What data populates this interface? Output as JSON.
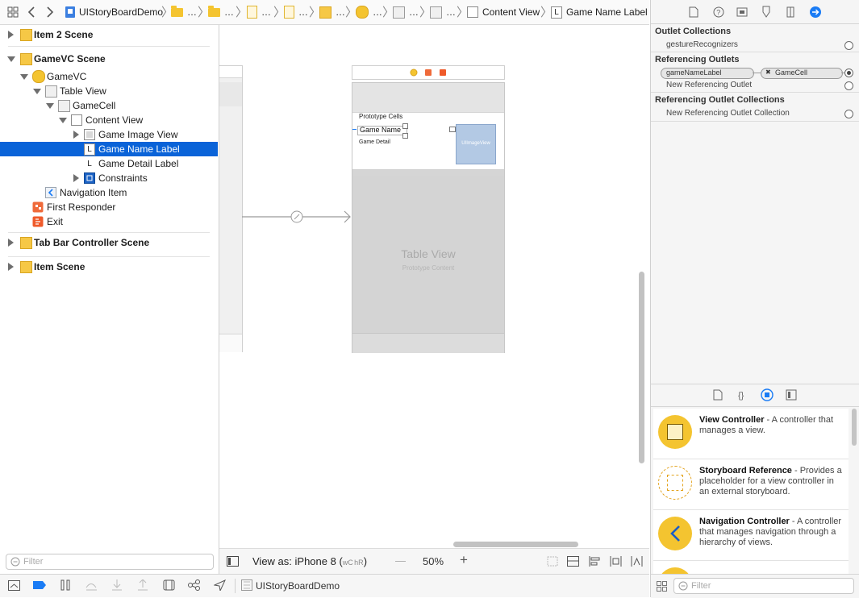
{
  "jumpbar": {
    "project": "UIStoryBoardDemo",
    "ellipsis": "…",
    "content_view": "Content View",
    "label_glyph": "L",
    "selected": "Game Name Label"
  },
  "outline": {
    "items": [
      {
        "label": "Item 2 Scene"
      },
      {
        "label": "GameVC Scene"
      },
      {
        "label": "GameVC"
      },
      {
        "label": "Table View"
      },
      {
        "label": "GameCell"
      },
      {
        "label": "Content View"
      },
      {
        "label": "Game Image View"
      },
      {
        "label": "Game Name Label"
      },
      {
        "label": "Game Detail Label"
      },
      {
        "label": "Constraints"
      },
      {
        "label": "Navigation Item"
      },
      {
        "label": "First Responder"
      },
      {
        "label": "Exit"
      },
      {
        "label": "Tab Bar Controller Scene"
      },
      {
        "label": "Item Scene"
      }
    ],
    "label_glyph": "L",
    "filter_placeholder": "Filter"
  },
  "canvas": {
    "prototype_cells": "Prototype Cells",
    "cell_title": "Game Name",
    "cell_detail": "Game Detail",
    "image_view": "UIImageView",
    "table_view": "Table View",
    "prototype_content": "Prototype Content"
  },
  "bottombar": {
    "view_as": "View as: iPhone 8 (",
    "wc": "wC",
    "hr": "hR",
    "close_paren": ")",
    "minus": "—",
    "zoom": "50%",
    "plus": "+"
  },
  "statusbar": {
    "scheme": "UIStoryBoardDemo"
  },
  "inspector": {
    "outlet_collections": "Outlet Collections",
    "gesture_recognizers": "gestureRecognizers",
    "referencing_outlets": "Referencing Outlets",
    "outlet_name": "gameNameLabel",
    "outlet_target": "GameCell",
    "outlet_x": "✖",
    "new_ref_outlet": "New Referencing Outlet",
    "ref_outlet_collections": "Referencing Outlet Collections",
    "new_ref_outlet_collection": "New Referencing Outlet Collection"
  },
  "library": {
    "items": [
      {
        "title": "View Controller",
        "desc": " - A controller that manages a view."
      },
      {
        "title": "Storyboard Reference",
        "desc": " - Provides a placeholder for a view controller in an external storyboard."
      },
      {
        "title": "Navigation Controller",
        "desc": " - A controller that manages navigation through a hierarchy of views."
      }
    ],
    "filter_placeholder": "Filter"
  },
  "colors": {
    "selection": "#0a63d8",
    "accent": "#1a7cf5",
    "storyboard_yellow": "#f4c430"
  }
}
